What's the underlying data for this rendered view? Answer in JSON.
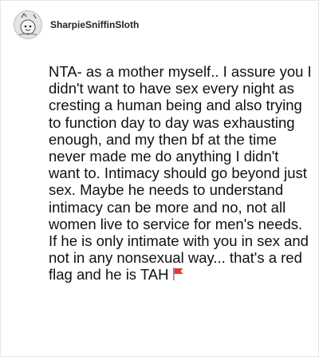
{
  "post": {
    "author": "SharpieSniffinSloth",
    "avatar_icon": "sloth-sketch-avatar",
    "text": "NTA- as a mother myself.. I assure you I didn't want to have sex every night as cresting a human being and also trying to function day to day was exhausting enough, and my then bf at the time never made me do anything I didn't want to. Intimacy should go beyond just sex. Maybe he needs to understand intimacy can be more and no, not all women live to service for men's needs. If he is only intimate with you in sex and not in any nonsexual way... that's a red flag and he is TAH",
    "trailing_emoji": "red-flag-icon"
  },
  "colors": {
    "card_border": "#e6e6e6",
    "text": "#111111",
    "flag_red": "#e53935"
  }
}
